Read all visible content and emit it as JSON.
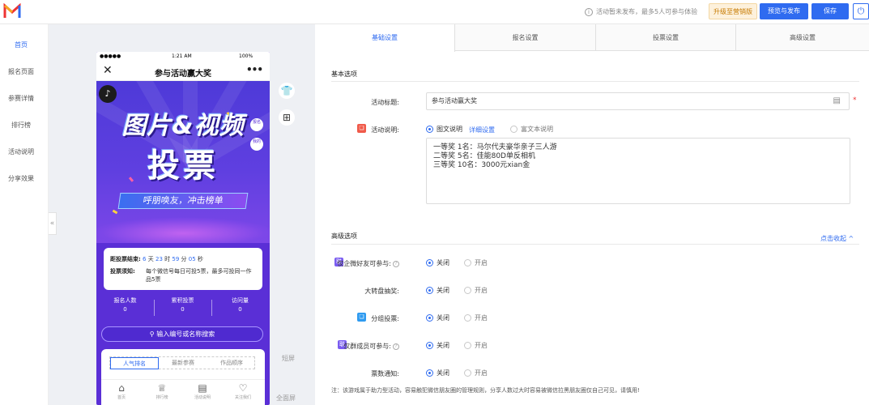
{
  "topbar": {
    "notice": "活动暂未发布，最多5人可参与体验",
    "upgrade_label": "升级至营销版",
    "preview_publish_label": "预览与发布",
    "save_label": "保存"
  },
  "leftnav": {
    "items": [
      "首页",
      "报名页面",
      "参赛详情",
      "排行榜",
      "活动说明",
      "分享效果"
    ]
  },
  "phone": {
    "status": {
      "carrier": "●●●●●",
      "time": "1:21 AM",
      "battery": "100%"
    },
    "nav_title": "参与活动赢大奖",
    "banner": {
      "title_line1": "图片&视频",
      "title_line2": "投票",
      "slogan": "呼朋唤友，冲击榜单",
      "side_btn1": "报名",
      "side_btn2": "我的"
    },
    "countdown": {
      "label": "距投票结束:",
      "days": "6",
      "days_unit": "天",
      "hours": "23",
      "hours_unit": "时",
      "minutes": "59",
      "minutes_unit": "分",
      "seconds": "05",
      "seconds_unit": "秒",
      "rule_label": "投票须知:",
      "rule_text": "每个微信号每日可投5票，最多可投同一作品5票"
    },
    "stats": [
      {
        "label": "报名人数",
        "value": "0"
      },
      {
        "label": "累积投票",
        "value": "0"
      },
      {
        "label": "访问量",
        "value": "0"
      }
    ],
    "search_placeholder": "输入编号或名称搜索",
    "list_tabs": [
      "人气排名",
      "最新参赛",
      "作品顺序"
    ],
    "bottom_nav": [
      "首页",
      "排行榜",
      "活动说明",
      "关注我们"
    ]
  },
  "preview_side": {
    "short_screen": "短屏",
    "full_screen": "全面屏"
  },
  "settings": {
    "tabs": [
      "基础设置",
      "报名设置",
      "投票设置",
      "高级设置"
    ],
    "basic_section": "基本选项",
    "title_label": "活动标题:",
    "title_value": "参与活动赢大奖",
    "desc_label": "活动说明:",
    "desc_option1": "图文说明",
    "desc_detail_link": "详细设置",
    "desc_option2": "富文本说明",
    "desc_text": "一等奖 1名：马尔代夫豪华亲子三人游\n二等奖 5名：佳能80D单反相机\n三等奖 10名：3000元xian金",
    "advanced_section": "高级选项",
    "collapse_link": "点击收起",
    "rows": [
      {
        "label": "仅企微好友可参与:",
        "on": "关闭",
        "off": "开启"
      },
      {
        "label": "大转盘抽奖:",
        "on": "关闭",
        "off": "开启"
      },
      {
        "label": "分组投票:",
        "on": "关闭",
        "off": "开启"
      },
      {
        "label": "仅群成员可参与:",
        "on": "关闭",
        "off": "开启"
      },
      {
        "label": "票数通知:",
        "on": "关闭",
        "off": "开启"
      }
    ],
    "note": "注：该游戏属于助力型活动，容易触犯微信朋友圈的管理规则，分享人数过大时容易被微信拉黑朋友圈仅自己可见，请慎用!"
  },
  "colors": {
    "accent": "#2f6bf0",
    "phone_bg": "#5a2fd6",
    "upgrade_text": "#c77a00"
  }
}
